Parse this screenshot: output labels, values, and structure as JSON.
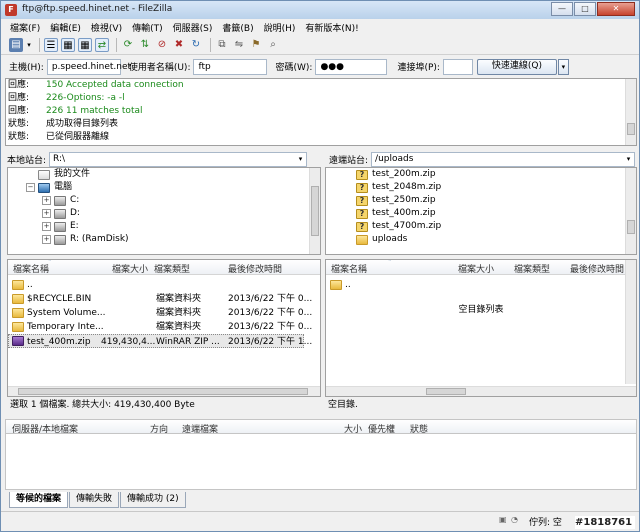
{
  "window": {
    "title": "ftp@ftp.speed.hinet.net - FileZilla"
  },
  "menu": [
    "檔案(F)",
    "編輯(E)",
    "檢視(V)",
    "傳輸(T)",
    "伺服器(S)",
    "書籤(B)",
    "說明(H)",
    "有新版本(N)!"
  ],
  "quickconnect": {
    "host_label": "主機(H):",
    "host": "p.speed.hinet.net",
    "user_label": "使用者名稱(U):",
    "user": "ftp",
    "pass_label": "密碼(W):",
    "pass": "●●●",
    "port_label": "連接埠(P):",
    "port": "",
    "button": "快速連線(Q)"
  },
  "log": [
    {
      "type": "回應:",
      "text": "150 Accepted data connection",
      "ok": true
    },
    {
      "type": "回應:",
      "text": "226-Options: -a -l",
      "ok": true
    },
    {
      "type": "回應:",
      "text": "226 11 matches total",
      "ok": true
    },
    {
      "type": "狀態:",
      "text": "成功取得目錄列表",
      "ok": false
    },
    {
      "type": "狀態:",
      "text": "已從伺服器離線",
      "ok": false
    }
  ],
  "local": {
    "site_label": "本地站台:",
    "path": "R:\\",
    "tree": [
      "我的文件",
      "電腦",
      "C:",
      "D:",
      "E:",
      "R: (RamDisk)"
    ],
    "columns": {
      "name": "檔案名稱",
      "size": "檔案大小",
      "type": "檔案類型",
      "modified": "最後修改時間"
    },
    "files": [
      {
        "name": "..",
        "size": "",
        "type": "",
        "modified": ""
      },
      {
        "name": "$RECYCLE.BIN",
        "size": "",
        "type": "檔案資料夾",
        "modified": "2013/6/22 下午 0..."
      },
      {
        "name": "System Volume...",
        "size": "",
        "type": "檔案資料夾",
        "modified": "2013/6/22 下午 0..."
      },
      {
        "name": "Temporary Inte...",
        "size": "",
        "type": "檔案資料夾",
        "modified": "2013/6/22 下午 0..."
      },
      {
        "name": "test_400m.zip",
        "size": "419,430,4...",
        "type": "WinRAR ZIP ...",
        "modified": "2013/6/22 下午 1..."
      }
    ],
    "status": "選取 1 個檔案. 總共大小: 419,430,400 Byte"
  },
  "remote": {
    "site_label": "遠端站台:",
    "path": "/uploads",
    "tree": [
      "test_200m.zip",
      "test_2048m.zip",
      "test_250m.zip",
      "test_400m.zip",
      "test_4700m.zip",
      "uploads"
    ],
    "columns": {
      "name": "檔案名稱",
      "size": "檔案大小",
      "type": "檔案類型",
      "modified": "最後修改時間"
    },
    "files": [
      {
        "name": ".."
      }
    ],
    "empty": "空目錄列表",
    "status": "空目錄."
  },
  "queue": {
    "columns": {
      "server": "伺服器/本地檔案",
      "direction": "方向",
      "remote": "遠端檔案",
      "size": "大小",
      "priority": "優先權",
      "status": "狀態"
    },
    "tabs": [
      "等候的檔案",
      "傳輸失敗",
      "傳輸成功 (2)"
    ]
  },
  "statusbar": {
    "queue": "佇列: 空",
    "watermark": "#1818761"
  }
}
